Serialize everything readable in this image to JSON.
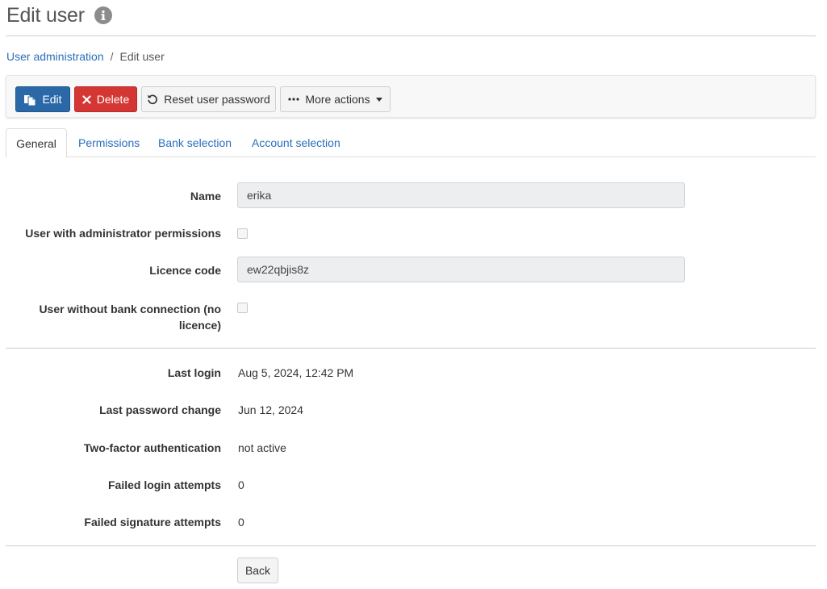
{
  "page": {
    "title": "Edit user",
    "info_icon": "info-icon"
  },
  "breadcrumb": {
    "parent": "User administration",
    "separator": "/",
    "current": "Edit user"
  },
  "toolbar": {
    "edit_label": "Edit",
    "delete_label": "Delete",
    "reset_label": "Reset user password",
    "more_label": "More actions",
    "edit_color": "#2a68a8",
    "delete_color": "#d43634"
  },
  "tabs": [
    {
      "label": "General",
      "active": true
    },
    {
      "label": "Permissions",
      "active": false
    },
    {
      "label": "Bank selection",
      "active": false
    },
    {
      "label": "Account selection",
      "active": false
    }
  ],
  "form": {
    "name_label": "Name",
    "name_value": "erika",
    "admin_label": "User with administrator permissions",
    "admin_checked": false,
    "licence_label": "Licence code",
    "licence_value": "ew22qbjis8z",
    "nobank_label_line1": "User without bank connection (no",
    "nobank_label_line2": "licence)",
    "nobank_checked": false
  },
  "details": {
    "last_login_label": "Last login",
    "last_login_value": "Aug 5, 2024, 12:42 PM",
    "last_pw_label": "Last password change",
    "last_pw_value": "Jun 12, 2024",
    "twofa_label": "Two-factor authentication",
    "twofa_value": "not active",
    "failed_login_label": "Failed login attempts",
    "failed_login_value": "0",
    "failed_sig_label": "Failed signature attempts",
    "failed_sig_value": "0"
  },
  "footer": {
    "back_label": "Back"
  }
}
